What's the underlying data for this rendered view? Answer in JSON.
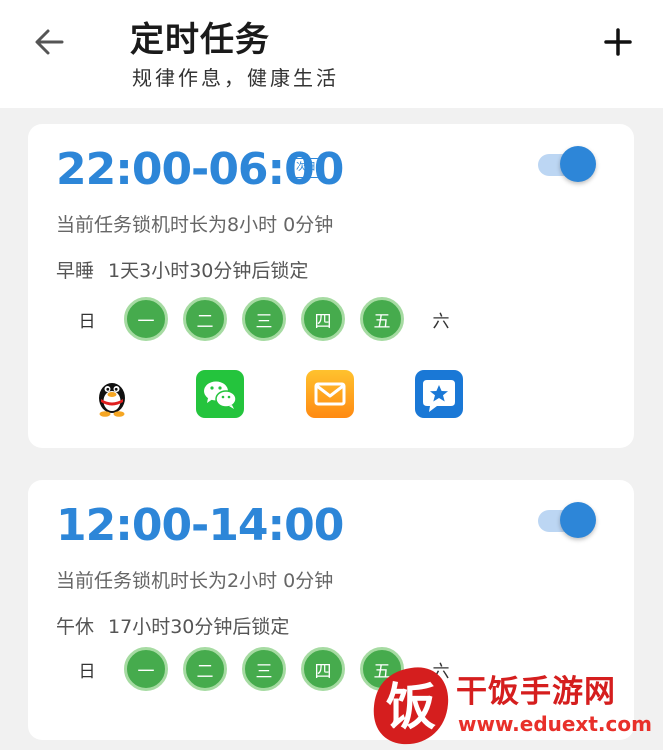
{
  "header": {
    "title": "定时任务",
    "subtitle": "规律作息，健康生活"
  },
  "tasks": [
    {
      "time": "22:00-06:00",
      "badge": "次日",
      "duration": "当前任务锁机时长为8小时 0分钟",
      "name": "早睡",
      "countdown": "1天3小时30分钟后锁定",
      "enabled": true,
      "days": [
        "日",
        "一",
        "二",
        "三",
        "四",
        "五",
        "六"
      ],
      "active_days": [
        false,
        true,
        true,
        true,
        true,
        true,
        false
      ],
      "apps": [
        "qq-icon",
        "wechat-icon",
        "mail-icon",
        "star-app-icon"
      ]
    },
    {
      "time": "12:00-14:00",
      "duration": "当前任务锁机时长为2小时 0分钟",
      "name": "午休",
      "countdown": "17小时30分钟后锁定",
      "enabled": true,
      "days": [
        "日",
        "一",
        "二",
        "三",
        "四",
        "五",
        "六"
      ],
      "active_days": [
        false,
        true,
        true,
        true,
        true,
        true,
        false
      ]
    }
  ],
  "colors": {
    "accent": "#2d86d8",
    "day_active": "#46ab4d",
    "watermark": "#d51e1e"
  },
  "watermark": {
    "brand": "干饭手游网",
    "logo_char": "饭",
    "url": "www.eduext.com"
  }
}
